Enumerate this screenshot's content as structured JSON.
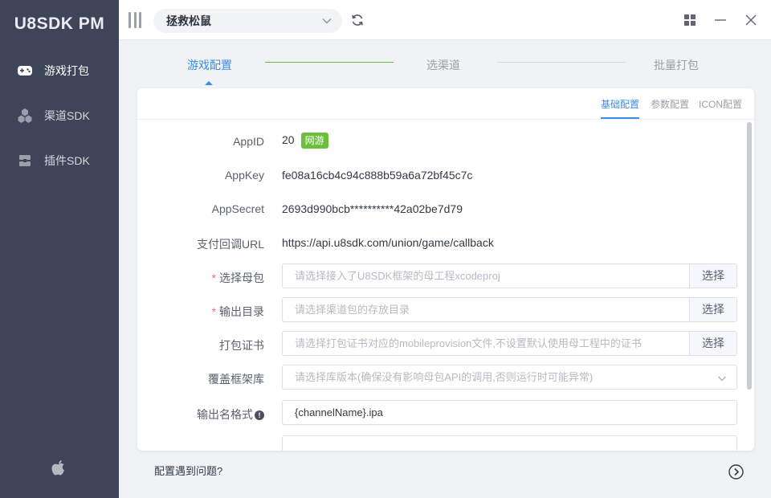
{
  "app": {
    "brand": "U8SDK PM"
  },
  "sidebar": {
    "items": [
      {
        "label": "游戏打包",
        "icon": "gamepad-icon",
        "active": true
      },
      {
        "label": "渠道SDK",
        "icon": "cubes-icon",
        "active": false
      },
      {
        "label": "插件SDK",
        "icon": "plugin-icon",
        "active": false
      }
    ],
    "footer_icon": "apple-icon"
  },
  "topbar": {
    "project": "拯救松鼠",
    "icons": [
      "menu-toggle-icon",
      "refresh-icon",
      "grid-icon",
      "minimize-icon",
      "close-icon"
    ]
  },
  "steps": [
    {
      "label": "游戏配置",
      "active": true
    },
    {
      "label": "选渠道",
      "active": false
    },
    {
      "label": "批量打包",
      "active": false
    }
  ],
  "subtabs": [
    {
      "label": "基础配置",
      "active": true
    },
    {
      "label": "参数配置",
      "active": false
    },
    {
      "label": "ICON配置",
      "active": false
    }
  ],
  "form": {
    "appid": {
      "label": "AppID",
      "value": "20",
      "tag": "网游"
    },
    "appkey": {
      "label": "AppKey",
      "value": "fe08a16cb4c94c888b59a6a72bf45c7c"
    },
    "appsecret": {
      "label": "AppSecret",
      "value": "2693d990bcb**********42a02be7d79"
    },
    "callback": {
      "label": "支付回调URL",
      "value": "https://api.u8sdk.com/union/game/callback"
    },
    "parent_pkg": {
      "label": "选择母包",
      "placeholder": "请选择接入了U8SDK框架的母工程xcodeproj",
      "button": "选择"
    },
    "output_dir": {
      "label": "输出目录",
      "placeholder": "请选择渠道包的存放目录",
      "button": "选择"
    },
    "cert": {
      "label": "打包证书",
      "placeholder": "请选择打包证书对应的mobileprovision文件,不设置默认使用母工程中的证书",
      "button": "选择"
    },
    "framework": {
      "label": "覆盖框架库",
      "placeholder": "请选择库版本(确保没有影响母包API的调用,否则运行时可能异常)"
    },
    "name_format": {
      "label": "输出名格式",
      "value": "{channelName}.ipa"
    }
  },
  "footer": {
    "help": "配置遇到问题?"
  },
  "colors": {
    "sidebar": "#3e4558",
    "accent": "#3a8ee6",
    "tag": "#6abf3b",
    "required": "#f56c6c"
  }
}
